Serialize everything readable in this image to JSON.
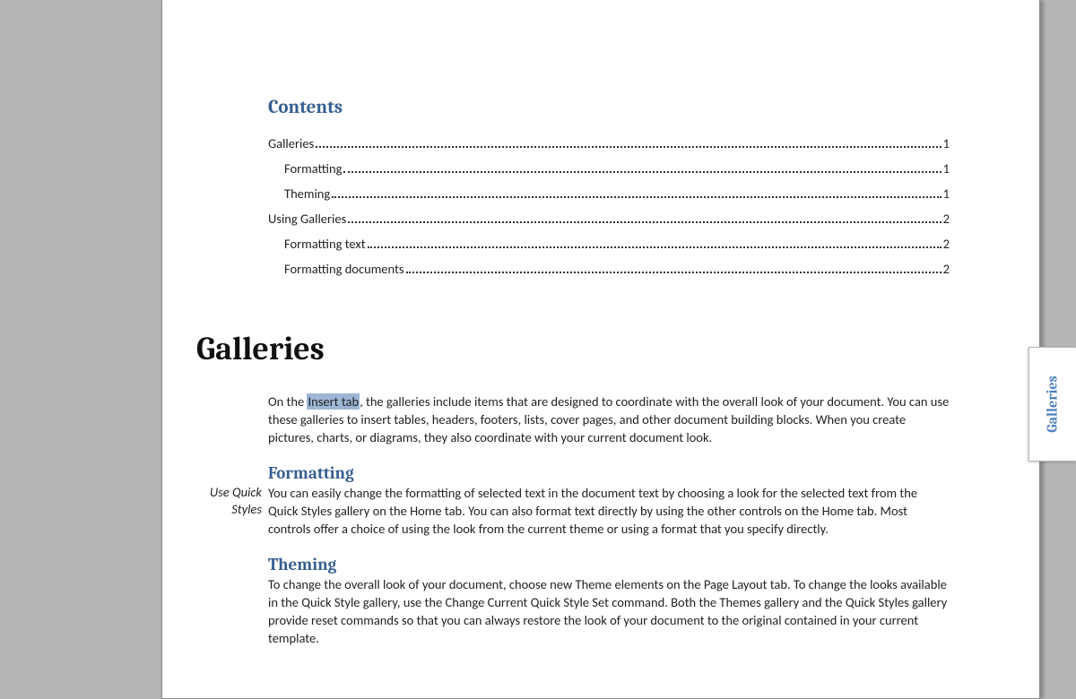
{
  "toc": {
    "title": "Contents",
    "items": [
      {
        "label": "Galleries",
        "page": "1",
        "level": 1
      },
      {
        "label": "Formatting",
        "page": "1",
        "level": 2
      },
      {
        "label": "Theming",
        "page": "1",
        "level": 2
      },
      {
        "label": "Using Galleries",
        "page": "2",
        "level": 1
      },
      {
        "label": "Formatting text",
        "page": "2",
        "level": 2
      },
      {
        "label": "Formatting documents",
        "page": "2",
        "level": 2
      }
    ]
  },
  "section": {
    "title": "Galleries",
    "intro_pre": "On the ",
    "intro_highlight": "Insert tab",
    "intro_post": ", the galleries include items that are designed to coordinate with the overall look of your document. You can use these galleries to insert tables, headers, footers, lists, cover pages, and other document building blocks. When you create pictures, charts, or diagrams, they also coordinate with your current document look."
  },
  "formatting": {
    "heading": "Formatting",
    "margin_note": "Use Quick Styles",
    "body": "You can easily change the formatting of selected text in the document text by choosing a look for the selected text from the Quick Styles gallery on the Home tab. You can also format text directly by using the other controls on the Home tab. Most controls offer a choice of using the look from the current theme or using a format that you specify directly."
  },
  "theming": {
    "heading": "Theming",
    "body": "To change the overall look of your document, choose new Theme elements on the Page Layout tab. To change the looks available in the Quick Style gallery, use the Change Current Quick Style Set command. Both the Themes gallery and the Quick Styles gallery provide reset commands so that you can always restore the look of your document to the original contained in your current template."
  },
  "thumb_tab": {
    "label": "Galleries"
  }
}
